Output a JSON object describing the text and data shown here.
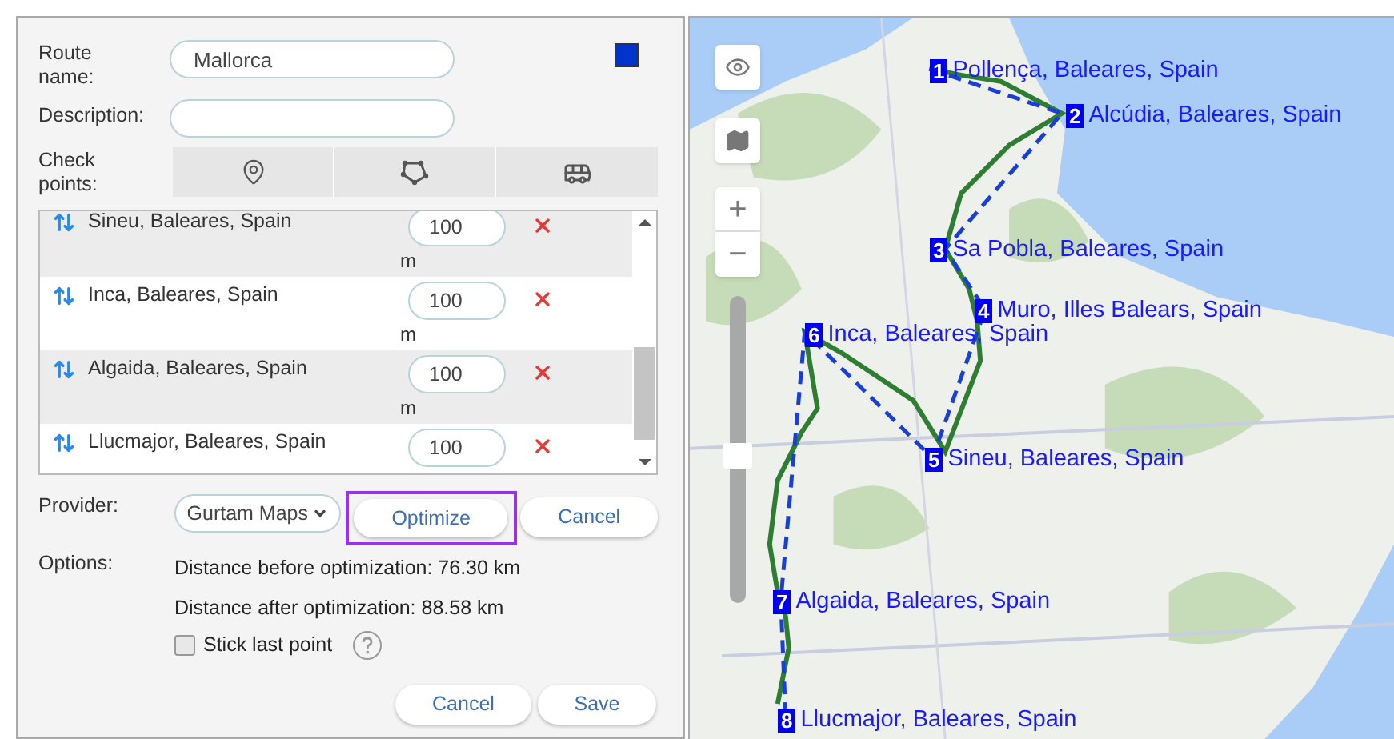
{
  "form": {
    "route_name": {
      "label": "Route name:",
      "value": "Mallorca"
    },
    "color": "#0033cc",
    "description": {
      "label": "Description:"
    },
    "checkpoints_label": "Check points:"
  },
  "checkpoints": [
    {
      "name": "Sineu, Baleares, Spain",
      "radius": "100",
      "unit": "m"
    },
    {
      "name": "Inca, Baleares, Spain",
      "radius": "100",
      "unit": "m"
    },
    {
      "name": "Algaida, Baleares, Spain",
      "radius": "100",
      "unit": "m"
    },
    {
      "name": "Llucmajor, Baleares, Spain",
      "radius": "100"
    }
  ],
  "provider": {
    "label": "Provider:",
    "value": "Gurtam Maps",
    "optimize": {
      "label": "Optimize",
      "focused": true
    },
    "cancel": "Cancel"
  },
  "options": {
    "label": "Options:",
    "before": "Distance before optimization: 76.30 km",
    "after": "Distance after optimization: 88.58 km",
    "stick_last_point": {
      "label": "Stick last point",
      "checked": false
    }
  },
  "footer": {
    "cancel": "Cancel",
    "save": "Save"
  },
  "map": {
    "zoom_in": "+",
    "zoom_out": "−",
    "zoom_slider": {
      "level": 0.48
    },
    "markers": [
      {
        "number": "1",
        "label": "Pollença, Baleares, Spain"
      },
      {
        "number": "2",
        "label": "Alcúdia, Baleares, Spain"
      },
      {
        "number": "3",
        "label": "Sa Pobla, Baleares, Spain"
      },
      {
        "number": "4",
        "label": "Muro, Illes Balears, Spain"
      },
      {
        "number": "6",
        "label": "Inca, Baleares, Spain"
      },
      {
        "number": "5",
        "label": "Sineu, Baleares, Spain"
      },
      {
        "number": "7",
        "label": "Algaida, Baleares, Spain"
      },
      {
        "number": "8",
        "label": "Llucmajor, Baleares, Spain"
      }
    ]
  }
}
